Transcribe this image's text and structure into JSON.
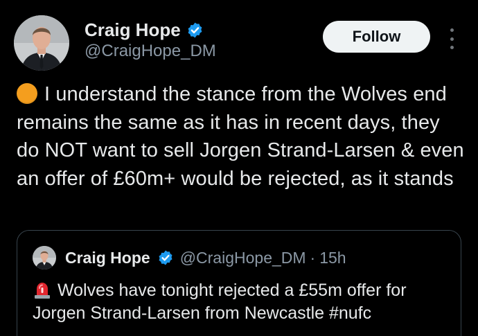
{
  "author": {
    "display_name": "Craig Hope",
    "handle": "@CraigHope_DM",
    "verified": true
  },
  "follow_label": "Follow",
  "tweet": {
    "emoji": "orange-circle",
    "text": "I understand the stance from the Wolves end remains the same as it has in recent days, they do NOT want to sell Jorgen Strand-Larsen & even an offer of £60m+ would be rejected, as it stands"
  },
  "quoted_tweet": {
    "display_name": "Craig Hope",
    "handle": "@CraigHope_DM",
    "separator": "·",
    "time": "15h",
    "emoji": "police-siren",
    "text": "Wolves have tonight rejected a £55m offer for Jorgen Strand-Larsen from Newcastle #nufc"
  },
  "colors": {
    "background": "#000000",
    "text": "#e7e9ea",
    "secondary_text": "#8b98a5",
    "verified_badge": "#1d9bf0",
    "follow_button_bg": "#eff3f4",
    "border": "#38444d"
  }
}
